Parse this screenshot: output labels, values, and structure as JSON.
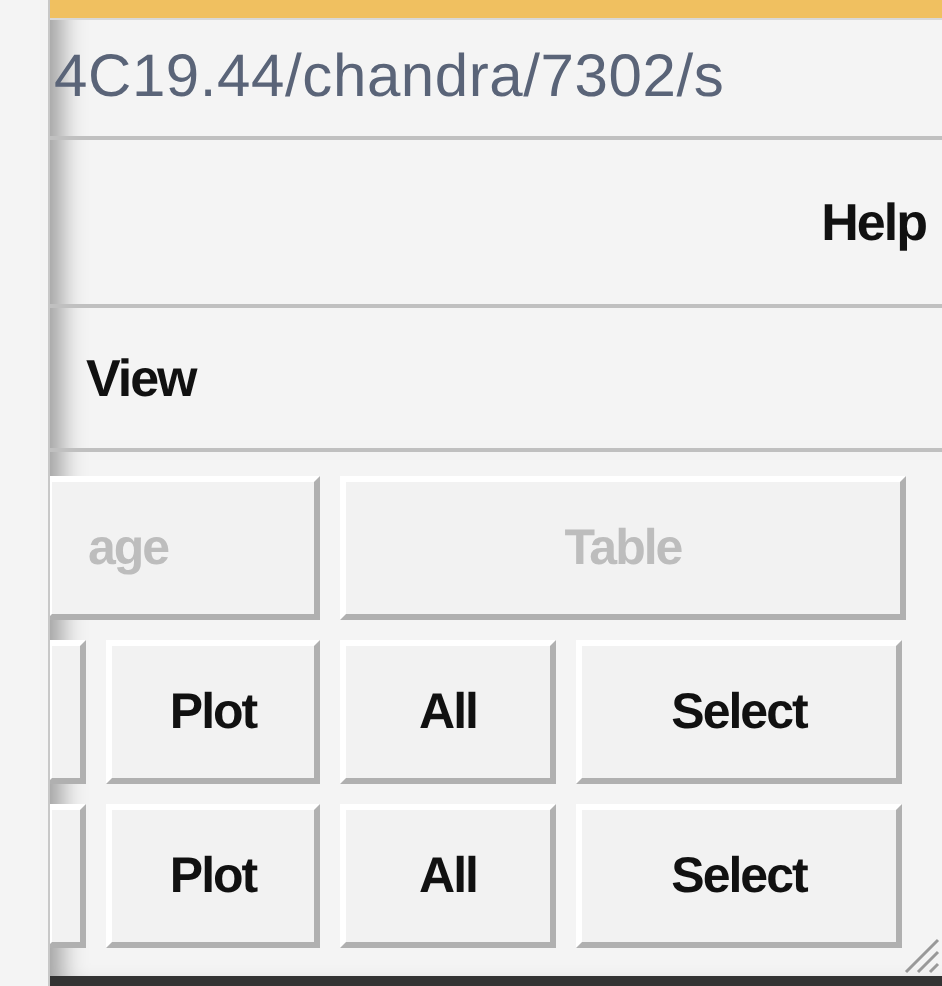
{
  "window": {
    "title": "4C19.44/chandra/7302/s"
  },
  "menu_bar": {
    "items": [
      {
        "label": "Help"
      }
    ]
  },
  "view_bar": {
    "items": [
      {
        "label": "View"
      }
    ]
  },
  "button_rows": [
    {
      "buttons": [
        {
          "kind": "wide",
          "label": "age",
          "disabled": true
        },
        {
          "kind": "wide",
          "label": "Table",
          "disabled": true
        }
      ]
    },
    {
      "buttons": [
        {
          "kind": "stub"
        },
        {
          "kind": "normal",
          "label": "Plot",
          "disabled": false
        },
        {
          "kind": "normal",
          "label": "All",
          "disabled": false
        },
        {
          "kind": "normal",
          "label": "Select",
          "disabled": false
        }
      ]
    },
    {
      "buttons": [
        {
          "kind": "stub"
        },
        {
          "kind": "normal",
          "label": "Plot",
          "disabled": false
        },
        {
          "kind": "normal",
          "label": "All",
          "disabled": false
        },
        {
          "kind": "normal",
          "label": "Select",
          "disabled": false
        }
      ]
    }
  ]
}
